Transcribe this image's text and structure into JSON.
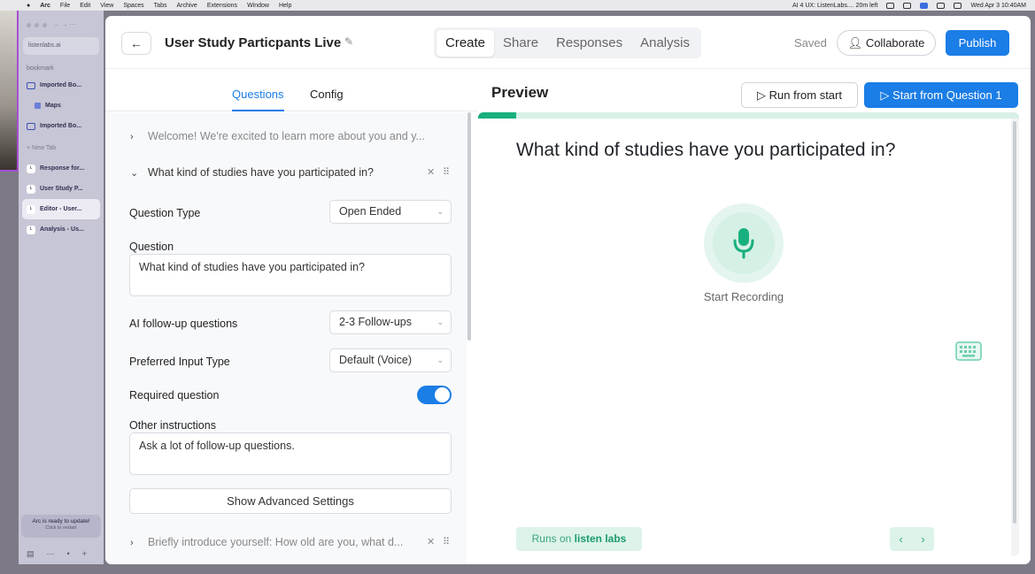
{
  "menubar": {
    "items": [
      "Arc",
      "File",
      "Edit",
      "View",
      "Spaces",
      "Tabs",
      "Archive",
      "Extensions",
      "Window",
      "Help"
    ],
    "status_text": "AI 4 UX: ListenLabs.... 20m left",
    "datetime": "Wed Apr 3  10:40AM"
  },
  "sidebar": {
    "url": "listenlabs.ai",
    "section_label": "bookmark",
    "bookmarks": [
      {
        "label": "Imported Bo...",
        "icon": "folder-icon"
      },
      {
        "label": "Maps",
        "icon": "map-icon"
      },
      {
        "label": "Imported Bo...",
        "icon": "folder-icon"
      }
    ],
    "new_tab": "+ New Tab",
    "tabs": [
      {
        "label": "Response for..."
      },
      {
        "label": "User Study P..."
      },
      {
        "label": "Editor - User..."
      },
      {
        "label": "Analysis - Us..."
      }
    ],
    "update_title": "Arc is ready to update!",
    "update_sub": "Click to restart"
  },
  "header": {
    "back_label": "←",
    "title": "User Study Particpants Live",
    "tabs": [
      {
        "label": "Create",
        "active": true
      },
      {
        "label": "Share",
        "active": false
      },
      {
        "label": "Responses",
        "active": false
      },
      {
        "label": "Analysis",
        "active": false
      }
    ],
    "saved": "Saved",
    "collaborate": "Collaborate",
    "publish": "Publish"
  },
  "editor": {
    "subtabs": [
      "Questions",
      "Config"
    ],
    "collapsed_q1": "Welcome! We're excited to learn more about you and y...",
    "open_question": "What kind of studies have you participated in?",
    "question_type_label": "Question Type",
    "question_type_value": "Open Ended",
    "question_label": "Question",
    "question_value": "What kind of studies have you participated in?",
    "followup_label": "AI follow-up questions",
    "followup_value": "2-3 Follow-ups",
    "input_type_label": "Preferred Input Type",
    "input_type_value": "Default (Voice)",
    "required_label": "Required question",
    "required_on": true,
    "other_label": "Other instructions",
    "other_value": "Ask a lot of follow-up questions.",
    "advanced_button": "Show Advanced Settings",
    "collapsed_q3": "Briefly introduce yourself: How old are you, what d..."
  },
  "preview": {
    "title": "Preview",
    "run_from_start": "Run from start",
    "start_from_question": "Start from Question 1",
    "progress_fraction": 0.07,
    "question": "What kind of studies have you participated in?",
    "record_label": "Start Recording",
    "runs_on_prefix": "Runs on",
    "runs_on_brand": "listen labs",
    "prev_arrow": "‹",
    "next_arrow": "›"
  },
  "colors": {
    "accent": "#1b7de6",
    "brand_green": "#18b07e",
    "sidebar_bg": "#c7c6d6"
  }
}
